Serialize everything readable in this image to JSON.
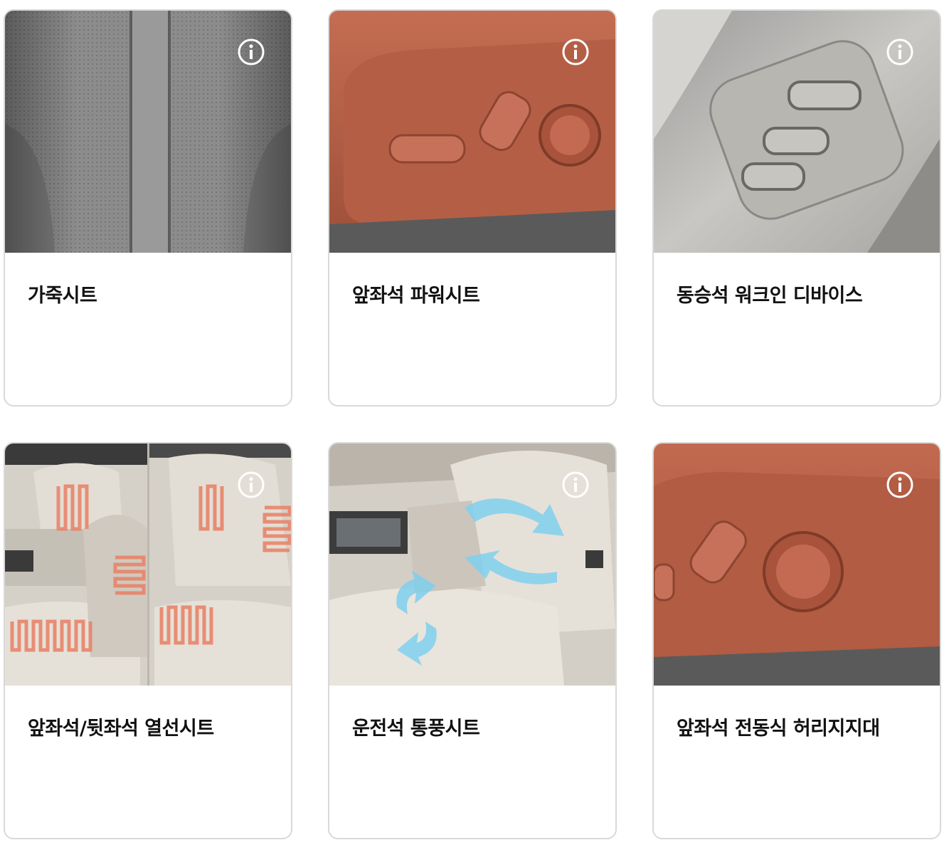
{
  "cards": [
    {
      "title": "가죽시트",
      "photo": "leather-seat-texture-photo",
      "info_icon": "info-icon"
    },
    {
      "title": "앞좌석 파워시트",
      "photo": "power-seat-controls-photo",
      "info_icon": "info-icon"
    },
    {
      "title": "동승석 워크인 디바이스",
      "photo": "walk-in-device-buttons-photo",
      "info_icon": "info-icon"
    },
    {
      "title": "앞좌석/뒷좌석 열선시트",
      "photo": "heated-seats-photo",
      "info_icon": "info-icon"
    },
    {
      "title": "운전석 통풍시트",
      "photo": "ventilated-seat-photo",
      "info_icon": "info-icon"
    },
    {
      "title": "앞좌석 전동식 허리지지대",
      "photo": "lumbar-support-control-photo",
      "info_icon": "info-icon"
    }
  ],
  "colors": {
    "card_border": "#d9d9d9",
    "title_text": "#111111",
    "brown_trim": "#b8624a",
    "leather_gray": "#8a8a8a",
    "seat_beige": "#d9d4cb",
    "heating_orange": "#e8846a",
    "cooling_blue": "#7fd0ee"
  }
}
